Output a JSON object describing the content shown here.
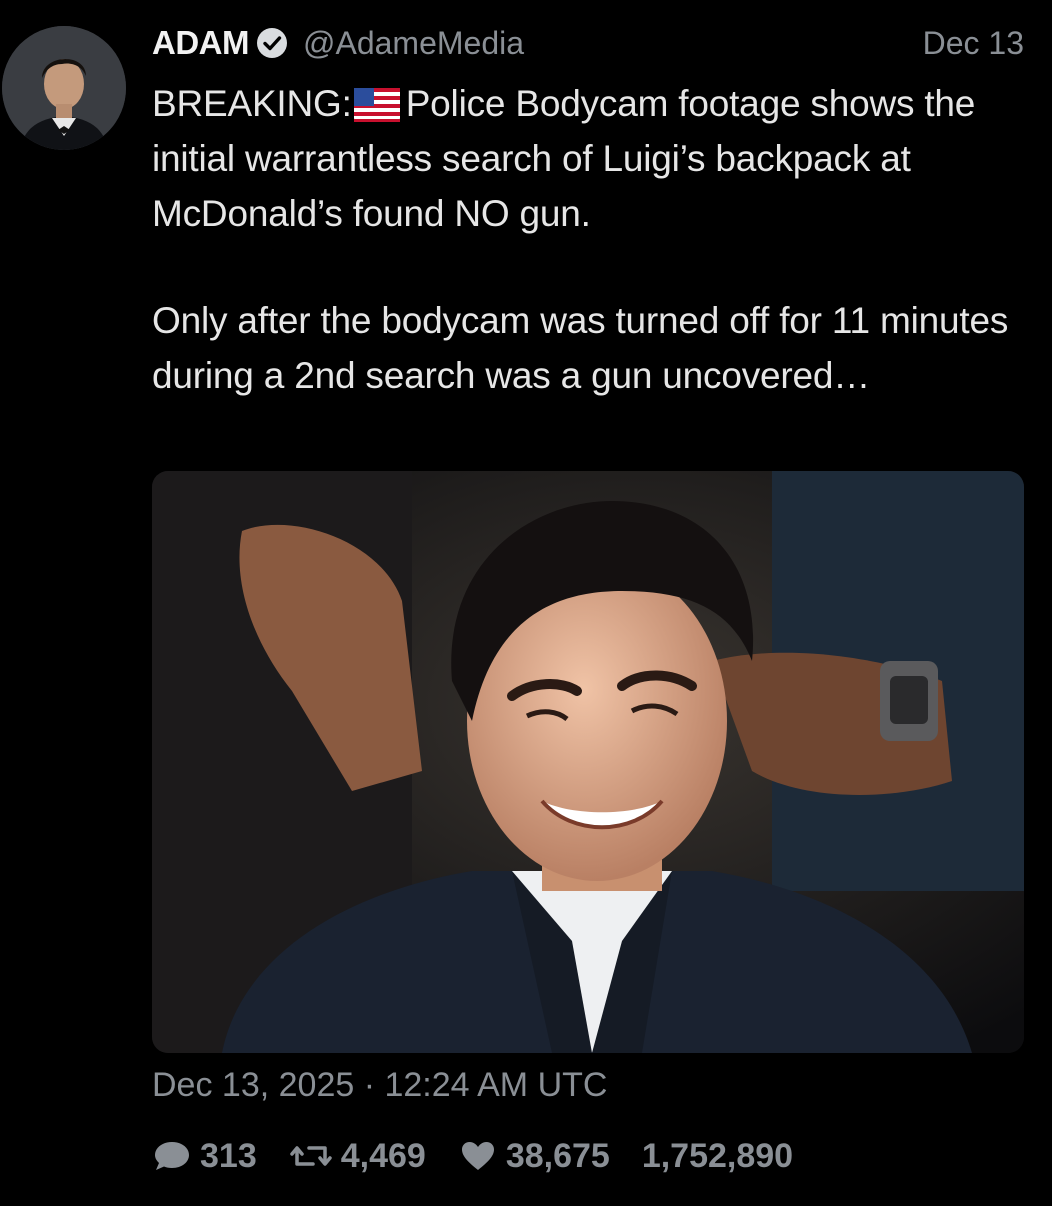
{
  "author": {
    "name": "ADAM",
    "handle": "@AdameMedia",
    "date": "Dec 13"
  },
  "tweet": {
    "prefix": "BREAKING:",
    "line1": "Police Bodycam footage shows the initial warrantless search of Luigi’s backpack at McDonald’s found NO gun.",
    "paragraph2": "Only after the bodycam was turned off for 11 minutes during a 2nd search was a gun uncovered…"
  },
  "timestamp": "Dec 13, 2025 · 12:24 AM UTC",
  "stats": {
    "replies": "313",
    "retweets": "4,469",
    "likes": "38,675",
    "views": "1,752,890"
  },
  "icons": [
    "verified-icon",
    "us-flag-icon",
    "reply-icon",
    "retweet-icon",
    "like-icon"
  ],
  "colors": {
    "background": "#000000",
    "text": "#e6e6e6",
    "muted": "#8a8f95"
  }
}
